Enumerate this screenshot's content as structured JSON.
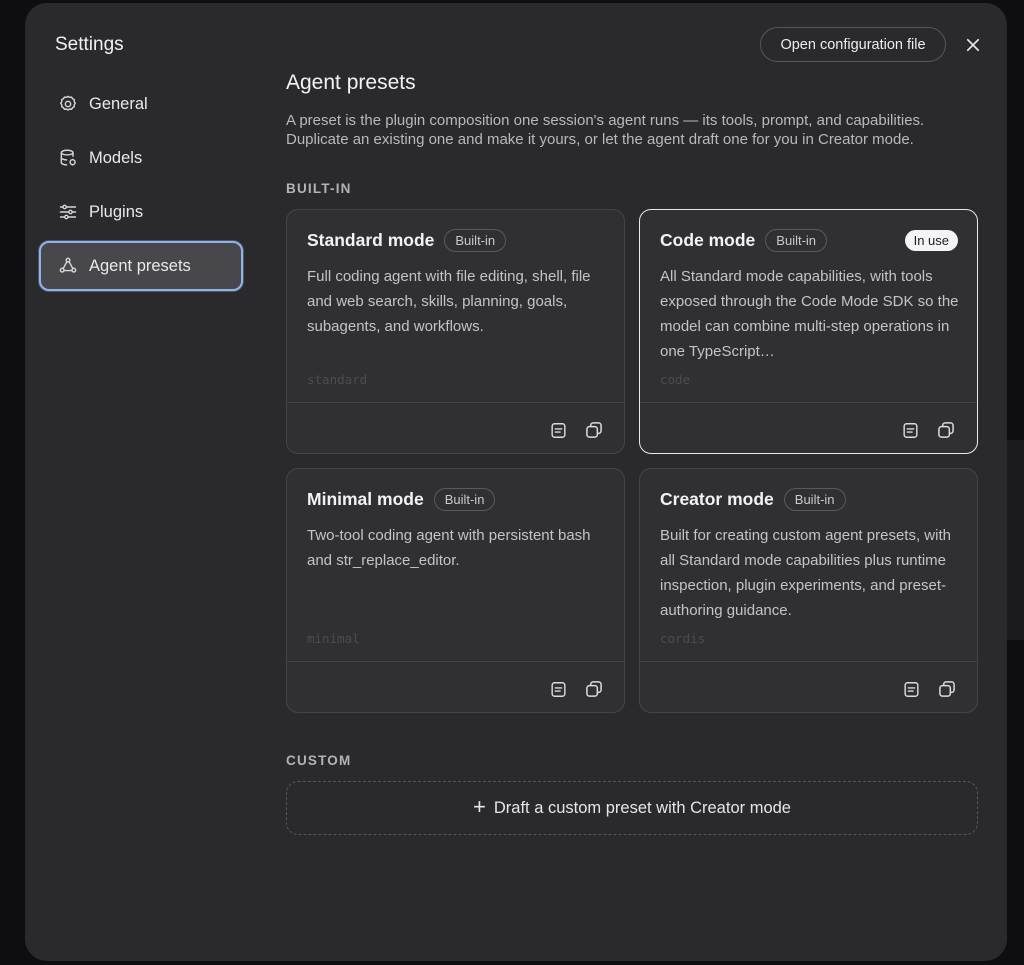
{
  "settings_title": "Settings",
  "nav": {
    "items": [
      {
        "label": "General",
        "icon": "gear-icon"
      },
      {
        "label": "Models",
        "icon": "database-icon"
      },
      {
        "label": "Plugins",
        "icon": "sliders-icon"
      },
      {
        "label": "Agent presets",
        "icon": "agent-presets-icon",
        "active": true
      }
    ]
  },
  "header": {
    "open_config_label": "Open configuration file",
    "close_icon": "close-icon"
  },
  "page": {
    "title": "Agent presets",
    "description": "A preset is the plugin composition one session's agent runs — its tools, prompt, and capabilities. Duplicate an existing one and make it yours, or let the agent draft one for you in Creator mode."
  },
  "builtin": {
    "section_label": "BUILT-IN",
    "cards": [
      {
        "title": "Standard mode",
        "badge": "Built-in",
        "description": "Full coding agent with file editing, shell, file and web search, skills, planning, goals, subagents, and workflows.",
        "id": "standard",
        "in_use": false
      },
      {
        "title": "Code mode",
        "badge": "Built-in",
        "description": "All Standard mode capabilities, with tools exposed through the Code Mode SDK so the model can combine multi-step operations in one TypeScript…",
        "id": "code",
        "in_use": true,
        "in_use_label": "In use"
      },
      {
        "title": "Minimal mode",
        "badge": "Built-in",
        "description": "Two-tool coding agent with persistent bash and str_replace_editor.",
        "id": "minimal",
        "in_use": false
      },
      {
        "title": "Creator mode",
        "badge": "Built-in",
        "description": "Built for creating custom agent presets, with all Standard mode capabilities plus runtime inspection, plugin experiments, and preset-authoring guidance.",
        "id": "cordis",
        "in_use": false
      }
    ]
  },
  "custom": {
    "section_label": "CUSTOM",
    "draft_button_label": "Draft a custom preset with Creator mode",
    "draft_button_icon": "plus-icon"
  },
  "colors": {
    "dialog_bg": "#2a2a2d",
    "active_border": "#8fb3e8",
    "in_use_badge_bg": "#f4f4f6"
  }
}
